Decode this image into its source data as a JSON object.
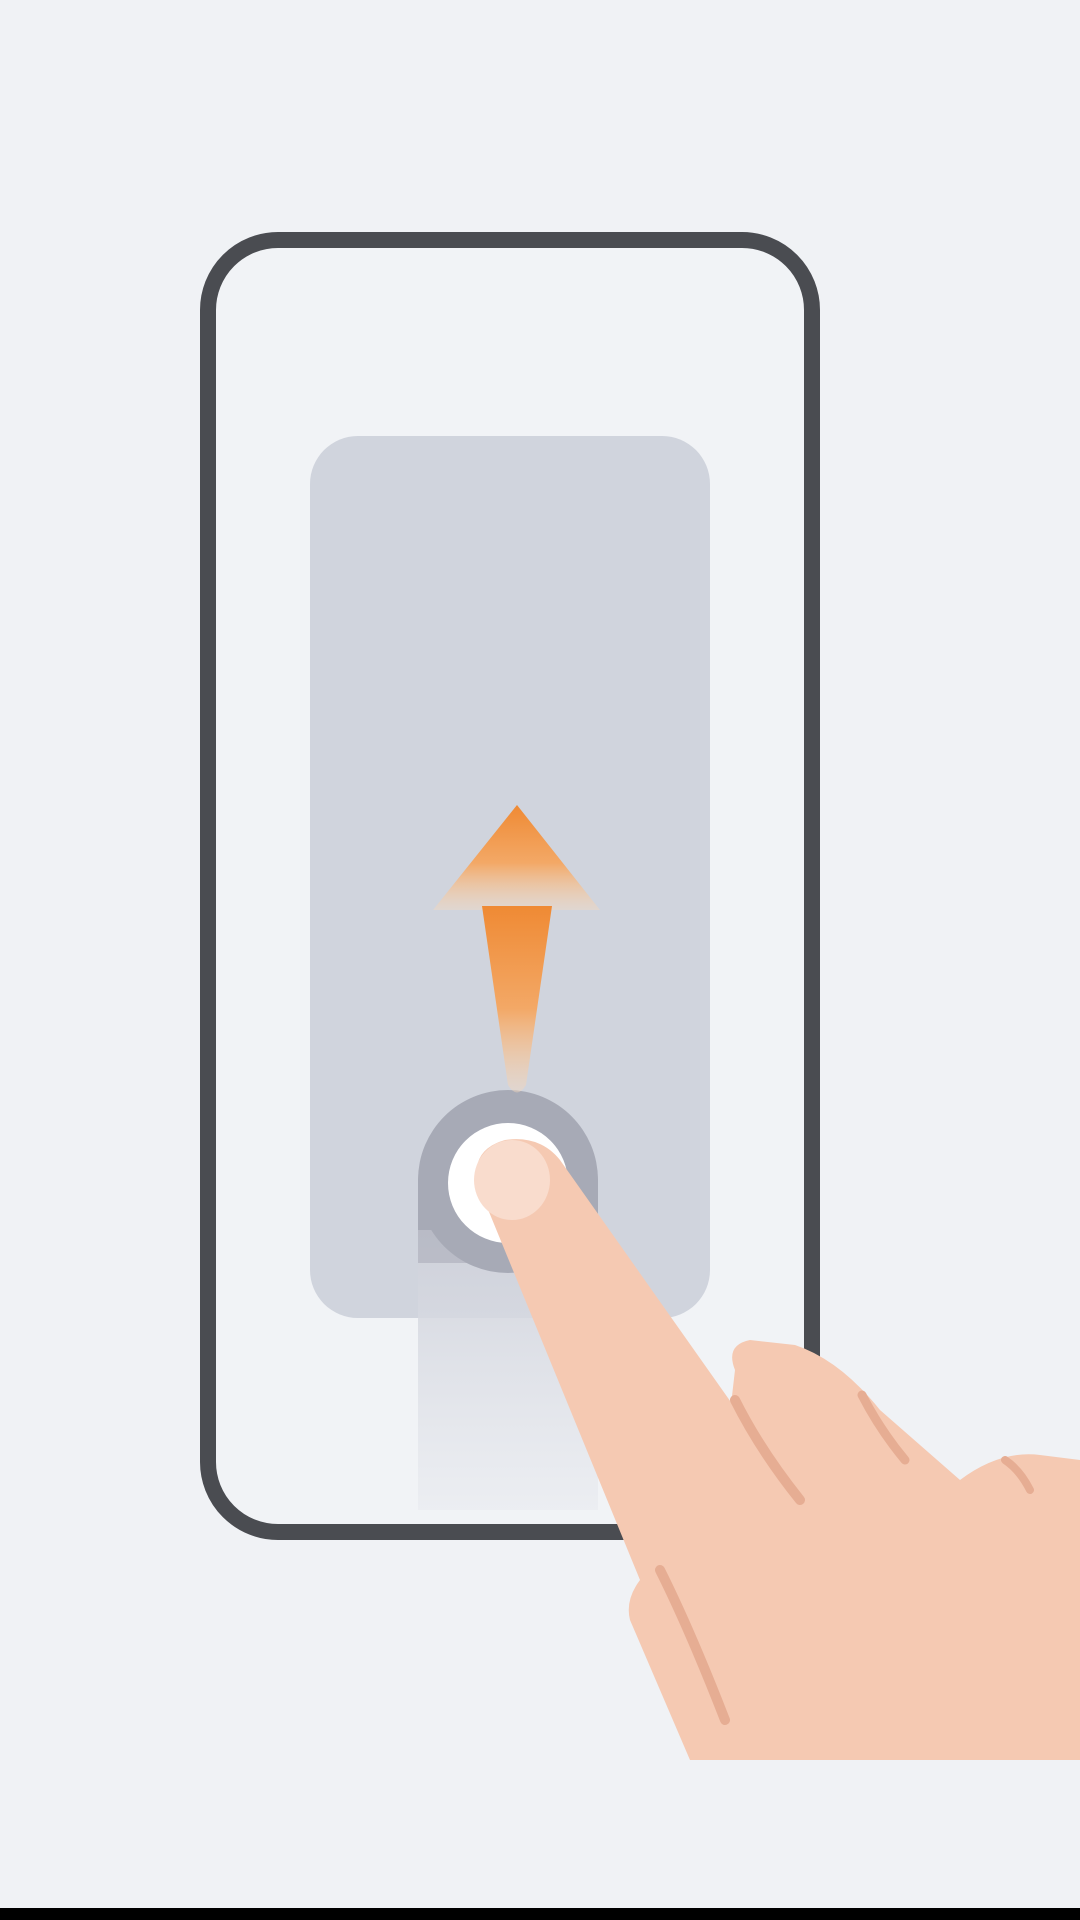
{
  "screen": {
    "background_color": "#f0f2f5",
    "bottom_bar_color": "#000000"
  },
  "illustration": {
    "gesture": "swipe-up",
    "phone_frame_color": "#4a4c51",
    "card_color": "#d0d4dd",
    "touch_ring_color": "#a7aab6",
    "touch_dot_color": "#ffffff",
    "arrow_color_top": "#ef8a34",
    "arrow_color_bottom": "#f6c9a0",
    "hand_color": "#f5c9b2",
    "hand_shadow_color": "#e6ad93",
    "icons": [
      "phone-frame-icon",
      "swipe-up-arrow-icon",
      "touch-point-icon",
      "pointing-hand-icon"
    ]
  }
}
